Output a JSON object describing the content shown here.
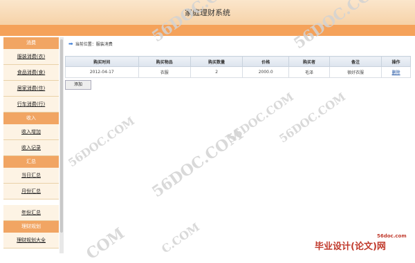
{
  "header": {
    "title": "家庭理财系统"
  },
  "sidebar": {
    "items": [
      {
        "type": "section",
        "label": "消费"
      },
      {
        "type": "link",
        "label": "服装消费(衣)"
      },
      {
        "type": "link",
        "label": "食品消费(食)"
      },
      {
        "type": "link",
        "label": "居家消费(住)"
      },
      {
        "type": "link",
        "label": "行车消费(行)"
      },
      {
        "type": "section",
        "label": "收入"
      },
      {
        "type": "link",
        "label": "收入增加"
      },
      {
        "type": "link",
        "label": "收入记录"
      },
      {
        "type": "section",
        "label": "汇总"
      },
      {
        "type": "link",
        "label": "当日汇总"
      },
      {
        "type": "link",
        "label": "月份汇总"
      },
      {
        "type": "gap",
        "label": ""
      },
      {
        "type": "link",
        "label": "年份汇总"
      },
      {
        "type": "section",
        "label": "理财规划"
      },
      {
        "type": "link",
        "label": "理财规划大全"
      }
    ]
  },
  "breadcrumb": {
    "label": "当前位置：",
    "page": "服装消费"
  },
  "table": {
    "columns": [
      "购买时间",
      "购买物品",
      "购买数量",
      "价格",
      "购买者",
      "备注",
      "操作"
    ],
    "rows": [
      [
        "2012-04-17",
        "衣服",
        "2",
        "2000.0",
        "毛泽",
        "很好衣服",
        "删除"
      ]
    ]
  },
  "actions": {
    "add_label": "添加"
  },
  "watermarks": [
    "56DOC.COM",
    "56DOC.COM",
    "56DOC.COM",
    "56DOC.COM",
    "56DOC.COM",
    "56DOC.COM",
    "COM",
    "C.COM"
  ],
  "logo": {
    "small": "56doc.com",
    "big": "毕业设计(论文)网"
  },
  "colors": {
    "header_bg": "#f6d2a8",
    "orange_bar": "#f5a25a",
    "section_bg": "#f1a563",
    "item_bg": "#fdf3e4"
  }
}
